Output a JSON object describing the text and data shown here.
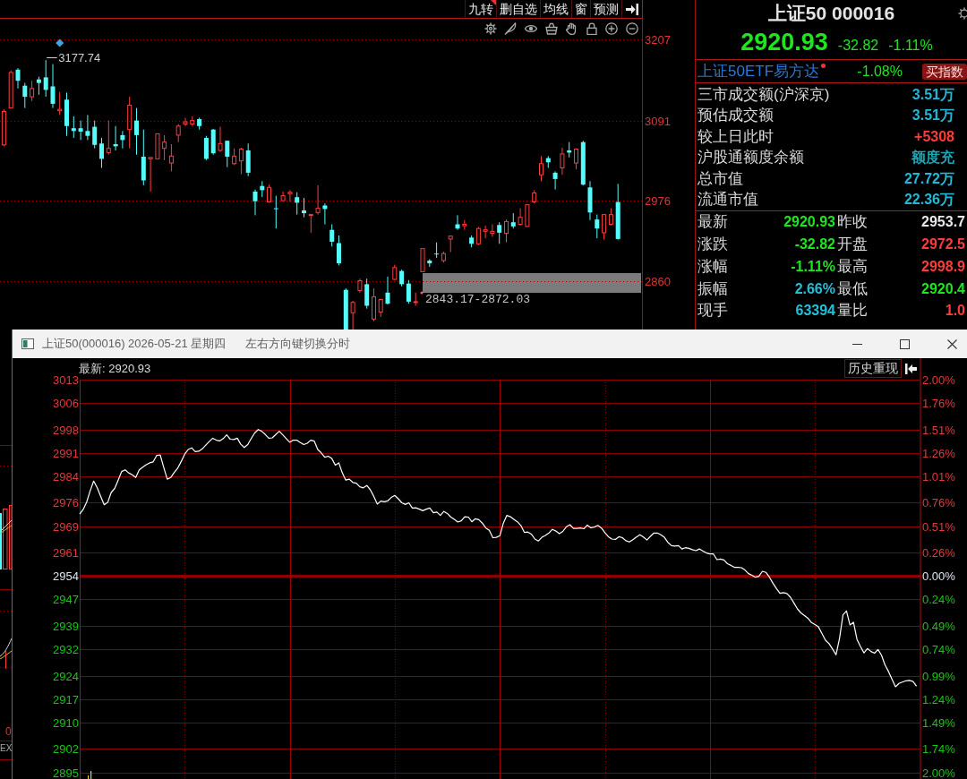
{
  "toolbar": {
    "buttons": [
      {
        "label": "九转",
        "marked": true
      },
      {
        "label": "删自选",
        "marked": false
      },
      {
        "label": "均线",
        "marked": false
      },
      {
        "label": "窗",
        "marked": false
      },
      {
        "label": "预测",
        "marked": false
      }
    ]
  },
  "kline": {
    "chart_data": {
      "type": "candlestick",
      "grid": true,
      "categories": [
        null,
        null,
        null,
        null,
        null,
        null,
        null,
        null,
        null,
        null,
        null,
        null,
        null,
        null,
        null,
        null,
        null,
        null,
        null,
        null,
        null,
        null,
        null,
        null,
        null,
        null,
        null,
        null,
        null,
        null,
        null,
        null,
        null,
        null,
        null,
        null,
        null,
        null,
        null,
        null,
        null,
        null,
        null,
        null,
        null,
        null,
        null,
        null,
        null,
        null,
        null,
        null,
        null,
        null,
        null,
        null,
        null,
        null,
        null,
        null,
        null,
        null,
        null,
        null,
        null,
        null,
        null,
        null,
        null,
        null,
        null,
        null,
        null,
        null,
        null,
        null,
        null,
        null,
        null,
        null,
        null,
        null,
        null,
        null,
        null,
        null,
        null,
        null,
        null,
        null,
        null,
        null
      ],
      "ohlc": [
        [
          3056,
          3107,
          3054,
          3104
        ],
        [
          3109,
          3163,
          3109,
          3160
        ],
        [
          3164,
          3166,
          3137,
          3148
        ],
        [
          3141,
          3145,
          3109,
          3125
        ],
        [
          3125,
          3148,
          3119,
          3137
        ],
        [
          3150,
          3154,
          3128,
          3145
        ],
        [
          3153,
          3177.74,
          3125,
          3135
        ],
        [
          3140,
          3172,
          3109,
          3115
        ],
        [
          3105,
          3132,
          3099,
          3107
        ],
        [
          3121,
          3131,
          3069,
          3083
        ],
        [
          3080,
          3097,
          3066,
          3076
        ],
        [
          3080,
          3091,
          3063,
          3075
        ],
        [
          3076,
          3099,
          3063,
          3069
        ],
        [
          3082,
          3091,
          3051,
          3056
        ],
        [
          3058,
          3066,
          3023,
          3036
        ],
        [
          3045,
          3091,
          3042,
          3051
        ],
        [
          3057,
          3083,
          3048,
          3054
        ],
        [
          3070,
          3076,
          3051,
          3063
        ],
        [
          3078,
          3125,
          3051,
          3113
        ],
        [
          3091,
          3109,
          3042,
          3070
        ],
        [
          3039,
          3078,
          2998,
          3005
        ],
        [
          3036,
          3038,
          2989,
          3038
        ],
        [
          3036,
          3072,
          3036,
          3072
        ],
        [
          3051,
          3070,
          3034,
          3060
        ],
        [
          3030,
          3057,
          3018,
          3040
        ],
        [
          3070,
          3086,
          3060,
          3083
        ],
        [
          3086,
          3095,
          3083,
          3089
        ],
        [
          3086,
          3097,
          3083,
          3091
        ],
        [
          3093,
          3095,
          3078,
          3083
        ],
        [
          3066,
          3069,
          3034,
          3036
        ],
        [
          3078,
          3079,
          3042,
          3044
        ],
        [
          3048,
          3082,
          3046,
          3058
        ],
        [
          3062,
          3062,
          3024,
          3039
        ],
        [
          3029,
          3051,
          3027,
          3040
        ],
        [
          3033,
          3052,
          3014,
          3050
        ],
        [
          3048,
          3058,
          3011,
          3016
        ],
        [
          2989,
          2992,
          2955,
          2975
        ],
        [
          2997,
          3004,
          2981,
          2991
        ],
        [
          2974,
          2999,
          2973,
          2995
        ],
        [
          2965,
          2983,
          2936,
          2964
        ],
        [
          2976,
          2989,
          2976,
          2983
        ],
        [
          2986,
          2991,
          2974,
          2988
        ],
        [
          2981,
          2988,
          2956,
          2973
        ],
        [
          2962,
          2980,
          2952,
          2958
        ],
        [
          2955,
          2956,
          2930,
          2956
        ],
        [
          2959,
          2998,
          2956,
          2965
        ],
        [
          2969,
          2972,
          2942,
          2964
        ],
        [
          2934,
          2942,
          2910,
          2917
        ],
        [
          2915,
          2926,
          2883,
          2886
        ],
        null,
        null,
        [
          2847,
          2864,
          2844,
          2861
        ],
        [
          2856,
          2864,
          2821,
          2825
        ],
        [
          2806,
          2850,
          2803,
          2838
        ],
        [
          2816,
          2835,
          2809,
          2834
        ],
        [
          2844,
          2867,
          2827,
          2828
        ],
        [
          2863,
          2884,
          2862,
          2880
        ],
        [
          2875,
          2877,
          2853,
          2856
        ],
        [
          2857,
          2862,
          2828,
          2831
        ],
        [
          2830,
          2844,
          2825,
          2831
        ],
        [
          2874,
          2907,
          2874,
          2907
        ],
        [
          2890,
          2892,
          2881,
          2886
        ],
        [
          2900,
          2916,
          2894,
          2899
        ],
        [
          2890,
          2903,
          2887,
          2900
        ],
        [
          2921,
          2926,
          2902,
          2925
        ],
        [
          2942,
          2955,
          2934,
          2936
        ],
        [
          2940,
          2948,
          2934,
          2942
        ],
        [
          2923,
          2926,
          2909,
          2914
        ],
        [
          2914,
          2938,
          2912,
          2936
        ],
        [
          2932,
          2940,
          2922,
          2934
        ],
        [
          2929,
          2942,
          2924,
          2932
        ],
        [
          2941,
          2945,
          2914,
          2930
        ],
        [
          2929,
          2949,
          2916,
          2946
        ],
        [
          2945,
          2958,
          2936,
          2939
        ],
        [
          2942,
          2965,
          2940,
          2952
        ],
        [
          2939,
          2971,
          2938,
          2970
        ],
        [
          2974,
          2991,
          2972,
          2987
        ],
        [
          3013,
          3040,
          3004,
          3029
        ],
        [
          3037,
          3040,
          3023,
          3031
        ],
        [
          3016,
          3018,
          2992,
          3007
        ],
        [
          3023,
          3052,
          3013,
          3043
        ],
        [
          3048,
          3060,
          3038,
          3045
        ],
        [
          3030,
          3051,
          3021,
          3050
        ],
        [
          3060,
          3062,
          2998,
          2999
        ],
        [
          2995,
          3004,
          2948,
          2959
        ],
        [
          2949,
          2956,
          2922,
          2936
        ],
        [
          2930,
          2956,
          2920,
          2956
        ],
        [
          2942,
          2965,
          2940,
          2956
        ],
        [
          2974,
          3000,
          2920,
          2921
        ],
        null,
        null,
        null
      ],
      "ylim": [
        2791,
        3237
      ],
      "yticks": [
        {
          "value": 3207,
          "label": "3207"
        },
        {
          "value": 3091,
          "label": "3091"
        },
        {
          "value": 2976,
          "label": "2976"
        },
        {
          "value": 2860,
          "label": "2860"
        }
      ],
      "annotations": [
        "3177.74"
      ]
    },
    "range_label": "2843.17-2872.03"
  },
  "quote": {
    "title": "上证50 000016",
    "price": "2920.93",
    "change": "-32.82",
    "change_pct": "-1.11%",
    "etf": {
      "name": "上证50ETF易方达",
      "change": "-1.08%",
      "button": "买指数"
    },
    "stats": [
      {
        "label": "三市成交额(沪深京)",
        "value": "3.51万",
        "color": "#22b8d8"
      },
      {
        "label": "预估成交额",
        "value": "3.51万",
        "color": "#22b8d8"
      },
      {
        "label": "较上日此时",
        "value": "+5308",
        "color": "#ff3b3b"
      },
      {
        "label": "沪股通额度余额",
        "value": "额度充",
        "color": "#1aa8b8"
      },
      {
        "label": "总市值",
        "value": "27.72万",
        "color": "#22b8d8"
      },
      {
        "label": "流通市值",
        "value": "22.36万",
        "color": "#22b8d8"
      }
    ],
    "quotes": [
      {
        "cells": [
          {
            "label": "最新",
            "value": "2920.93",
            "color": "#1ee61e"
          },
          {
            "label": "昨收",
            "value": "2953.7",
            "color": "#e8e8e8"
          }
        ]
      },
      {
        "cells": [
          {
            "label": "涨跌",
            "value": "-32.82",
            "color": "#1ee61e"
          },
          {
            "label": "开盘",
            "value": "2972.5",
            "color": "#ff3b3b"
          }
        ]
      },
      {
        "cells": [
          {
            "label": "涨幅",
            "value": "-1.11%",
            "color": "#1ee61e"
          },
          {
            "label": "最高",
            "value": "2998.9",
            "color": "#ff3b3b"
          }
        ]
      },
      {
        "cells": [
          {
            "label": "振幅",
            "value": "2.66%",
            "color": "#22c0d8"
          },
          {
            "label": "最低",
            "value": "2920.4",
            "color": "#1ee61e"
          }
        ]
      },
      {
        "cells": [
          {
            "label": "现手",
            "value": "63394",
            "color": "#22c0d8"
          },
          {
            "label": "量比",
            "value": "1.0",
            "color": "#ff3b3b"
          }
        ]
      }
    ]
  },
  "popup": {
    "title": "上证50(000016) 2026-05-21 星期四",
    "hint": "左右方向键切换分时",
    "latest": "最新: 2920.93",
    "history_button": "历史重现",
    "percent_labels": [
      {
        "text": "2.00%",
        "color": "#e03a3a"
      },
      {
        "text": "1.76%",
        "color": "#e03a3a"
      },
      {
        "text": "1.51%",
        "color": "#e03a3a"
      },
      {
        "text": "1.26%",
        "color": "#e03a3a"
      },
      {
        "text": "1.01%",
        "color": "#e03a3a"
      },
      {
        "text": "0.76%",
        "color": "#e03a3a"
      },
      {
        "text": "0.51%",
        "color": "#e03a3a"
      },
      {
        "text": "0.26%",
        "color": "#e03a3a"
      },
      {
        "text": "0.00%",
        "color": "#dce4f0"
      },
      {
        "text": "0.24%",
        "color": "#14c814"
      },
      {
        "text": "0.49%",
        "color": "#14c814"
      },
      {
        "text": "0.74%",
        "color": "#14c814"
      },
      {
        "text": "0.99%",
        "color": "#14c814"
      },
      {
        "text": "1.24%",
        "color": "#14c814"
      },
      {
        "text": "1.49%",
        "color": "#14c814"
      },
      {
        "text": "1.74%",
        "color": "#14c814"
      },
      {
        "text": "2.00%",
        "color": "#14c814"
      }
    ],
    "chart_data": {
      "type": "line",
      "grid": true,
      "categories": [
        null,
        null,
        null,
        null,
        null,
        null,
        null,
        null,
        null,
        null,
        null,
        null,
        null,
        null,
        null,
        null,
        null,
        null,
        null,
        null,
        null,
        null,
        null,
        null,
        null,
        null,
        null,
        null,
        null,
        null,
        null,
        null,
        null,
        null,
        null,
        null,
        null,
        null,
        null,
        null,
        null,
        null,
        null,
        null,
        null,
        null,
        null,
        null,
        null,
        null,
        null,
        null,
        null,
        null,
        null,
        null,
        null,
        null,
        null,
        null,
        null,
        null,
        null,
        null,
        null,
        null,
        null,
        null,
        null,
        null,
        null,
        null,
        null,
        null,
        null,
        null,
        null,
        null,
        null,
        null,
        null,
        null,
        null,
        null,
        null,
        null,
        null,
        null,
        null,
        null,
        null,
        null,
        null,
        null,
        null,
        null,
        null,
        null,
        null,
        null,
        null,
        null,
        null,
        null,
        null,
        null,
        null,
        null,
        null,
        null,
        null,
        null,
        null,
        null,
        null,
        null,
        null,
        null,
        null,
        null,
        null,
        null,
        null,
        null,
        null,
        null,
        null,
        null,
        null,
        null,
        null,
        null,
        null,
        null,
        null,
        null,
        null,
        null,
        null,
        null,
        null,
        null,
        null,
        null,
        null,
        null,
        null,
        null,
        null,
        null,
        null,
        null,
        null,
        null,
        null,
        null,
        null,
        null,
        null,
        null,
        null,
        null,
        null,
        null,
        null,
        null,
        null,
        null,
        null,
        null,
        null,
        null,
        null,
        null,
        null,
        null,
        null,
        null,
        null,
        null,
        null,
        null,
        null,
        null,
        null,
        null,
        null,
        null,
        null,
        null,
        null,
        null,
        null,
        null,
        null,
        null,
        null,
        null,
        null,
        null,
        null,
        null,
        null,
        null,
        null,
        null,
        null,
        null,
        null,
        null,
        null,
        null,
        null,
        null,
        null,
        null,
        null,
        null,
        null,
        null,
        null,
        null,
        null,
        null,
        null,
        null,
        null,
        null,
        null,
        null,
        null,
        null,
        null,
        null,
        null,
        null,
        null,
        null,
        null,
        null
      ],
      "ylim": [
        2895,
        3013
      ],
      "yticks": [
        {
          "value": 3013,
          "label": "3013"
        },
        {
          "value": 3006,
          "label": "3006"
        },
        {
          "value": 2998,
          "label": "2998"
        },
        {
          "value": 2991,
          "label": "2991"
        },
        {
          "value": 2984,
          "label": "2984"
        },
        {
          "value": 2976,
          "label": "2976"
        },
        {
          "value": 2969,
          "label": "2969"
        },
        {
          "value": 2961,
          "label": "2961"
        },
        {
          "value": 2954,
          "label": "2954"
        },
        {
          "value": 2947,
          "label": "2947"
        },
        {
          "value": 2939,
          "label": "2939"
        },
        {
          "value": 2932,
          "label": "2932"
        },
        {
          "value": 2924,
          "label": "2924"
        },
        {
          "value": 2917,
          "label": "2917"
        },
        {
          "value": 2910,
          "label": "2910"
        },
        {
          "value": 2902,
          "label": "2902"
        },
        {
          "value": 2895,
          "label": "2895"
        }
      ],
      "series": [
        {
          "color": "#ffffff",
          "values": [
            2972.6,
            2974.0,
            2976.2,
            2979.6,
            2982.5,
            2980.5,
            2977.9,
            2975.4,
            2976.1,
            2979.1,
            2980.3,
            2982.8,
            2985.4,
            2985.9,
            2985.0,
            2984.4,
            2983.6,
            2985.9,
            2986.7,
            2987.4,
            2988.0,
            2988.3,
            2990.2,
            2990.4,
            2986.6,
            2983.1,
            2983.6,
            2985.1,
            2986.4,
            2988.4,
            2990.6,
            2992.0,
            2992.5,
            2991.4,
            2991.5,
            2992.2,
            2993.3,
            2994.4,
            2995.4,
            2994.8,
            2994.6,
            2995.3,
            2996.4,
            2995.1,
            2995.0,
            2995.4,
            2993.6,
            2992.6,
            2993.5,
            2995.3,
            2997.0,
            2998.0,
            2997.5,
            2996.5,
            2995.4,
            2995.5,
            2996.5,
            2997.5,
            2996.4,
            2995.3,
            2994.2,
            2994.8,
            2994.8,
            2994.1,
            2993.5,
            2993.9,
            2994.8,
            2994.5,
            2992.0,
            2991.0,
            2989.7,
            2990.0,
            2989.3,
            2987.3,
            2988.0,
            2985.0,
            2982.8,
            2983.1,
            2982.1,
            2981.9,
            2980.8,
            2980.5,
            2981.2,
            2979.9,
            2977.9,
            2975.6,
            2976.5,
            2976.3,
            2976.6,
            2977.6,
            2978.2,
            2977.2,
            2976.0,
            2975.5,
            2976.0,
            2974.4,
            2974.5,
            2974.1,
            2973.6,
            2974.1,
            2974.4,
            2973.0,
            2973.2,
            2972.2,
            2973.4,
            2972.8,
            2971.7,
            2971.0,
            2970.2,
            2970.6,
            2971.8,
            2971.7,
            2970.3,
            2971.2,
            2970.9,
            2969.9,
            2968.4,
            2967.7,
            2965.5,
            2965.6,
            2966.1,
            2969.9,
            2972.2,
            2971.8,
            2971.0,
            2970.3,
            2969.2,
            2967.1,
            2967.2,
            2966.6,
            2965.1,
            2964.5,
            2965.6,
            2966.2,
            2966.9,
            2968.0,
            2967.5,
            2966.7,
            2967.4,
            2968.8,
            2969.4,
            2968.3,
            2968.3,
            2968.4,
            2968.2,
            2969.3,
            2968.5,
            2968.7,
            2969.2,
            2968.4,
            2967.0,
            2965.8,
            2965.1,
            2965.0,
            2965.8,
            2965.5,
            2964.6,
            2964.2,
            2964.9,
            2965.7,
            2966.4,
            2965.7,
            2964.8,
            2965.9,
            2966.9,
            2966.9,
            2966.4,
            2965.6,
            2964.1,
            2963.1,
            2963.0,
            2963.1,
            2962.1,
            2962.5,
            2962.3,
            2961.9,
            2961.6,
            2962.1,
            2961.5,
            2960.9,
            2960.6,
            2960.6,
            2958.9,
            2959.1,
            2958.8,
            2957.7,
            2957.2,
            2956.6,
            2956.6,
            2956.5,
            2955.8,
            2954.7,
            2954.2,
            2953.6,
            2953.9,
            2955.4,
            2955.1,
            2953.6,
            2951.8,
            2950.2,
            2948.8,
            2949.0,
            2948.7,
            2947.6,
            2945.9,
            2944.1,
            2942.9,
            2942.1,
            2941.3,
            2940.0,
            2939.4,
            2938.7,
            2936.7,
            2934.7,
            2933.7,
            2932.1,
            2930.3,
            2935.2,
            2942.3,
            2943.5,
            2939.3,
            2940.1,
            2935.0,
            2932.8,
            2930.9,
            2932.2,
            2931.3,
            2930.8,
            2931.9,
            2930.2,
            2927.3,
            2925.3,
            2923.0,
            2920.7,
            2921.7,
            2922.1,
            2922.5,
            2922.6,
            2922.3,
            2920.9
          ]
        }
      ]
    }
  },
  "background_window": {
    "labels": [
      "0",
      "EX"
    ]
  }
}
